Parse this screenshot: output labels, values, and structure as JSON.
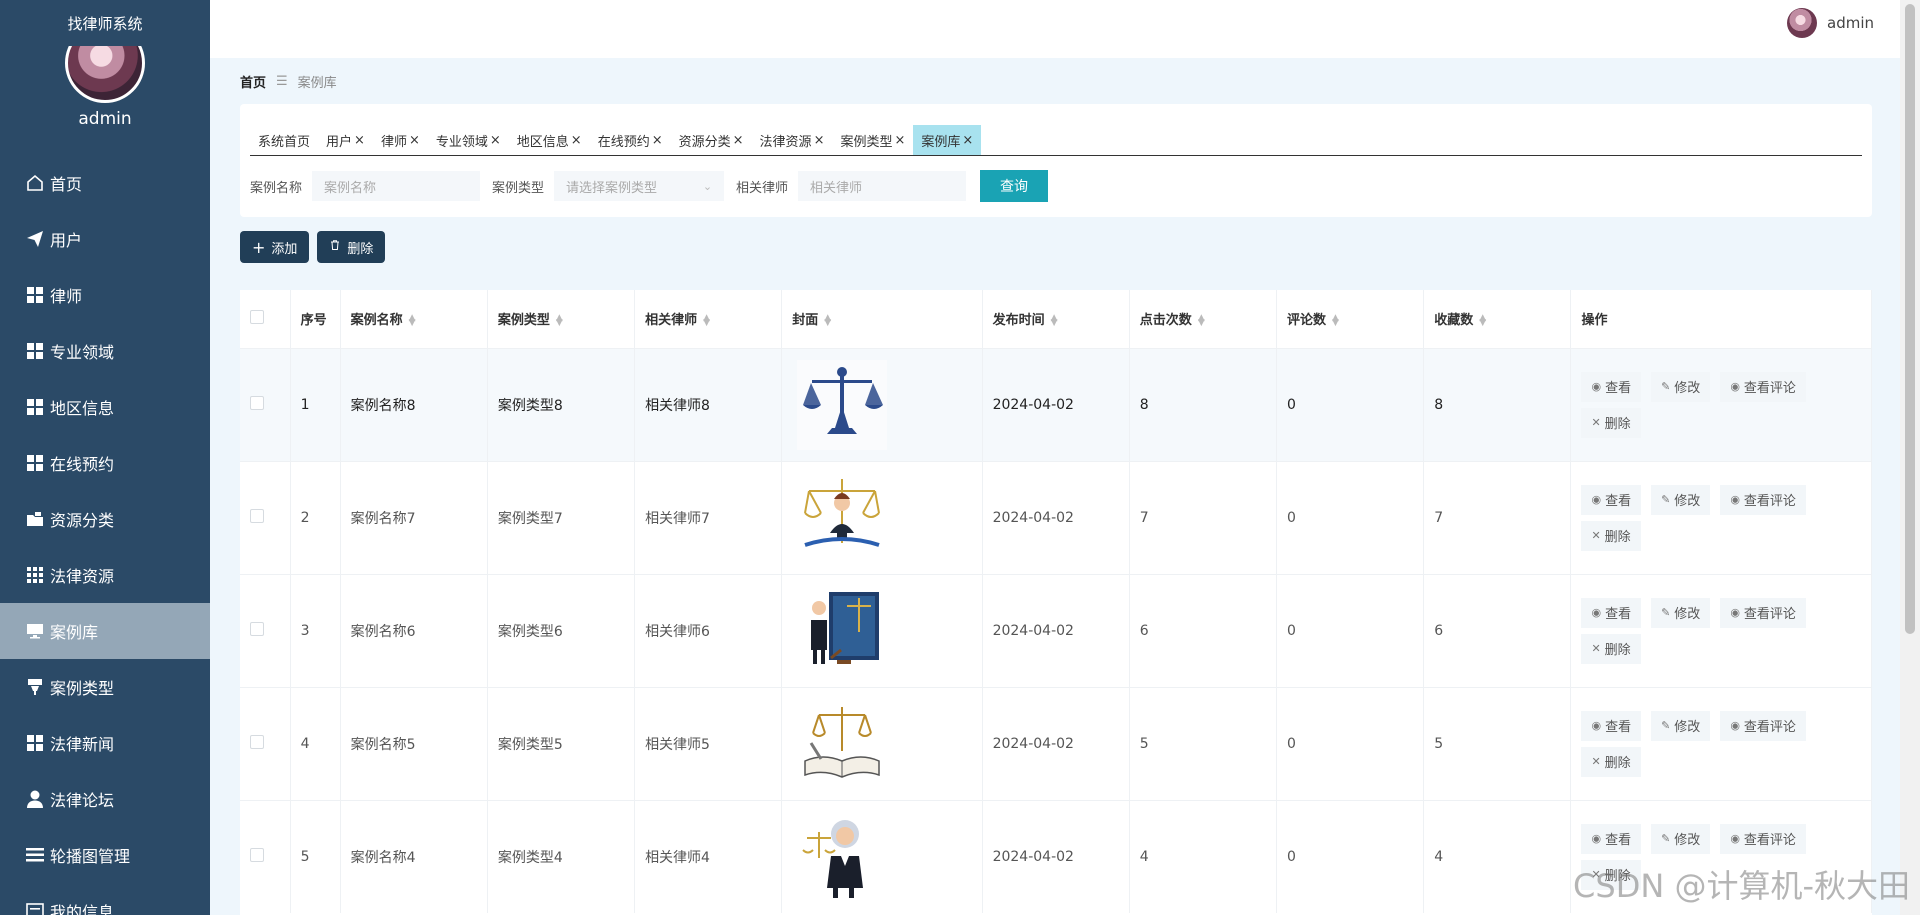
{
  "app": {
    "system_title": "找律师系统",
    "sidebar_user": "admin"
  },
  "header": {
    "username": "admin"
  },
  "sidebar": {
    "items": [
      {
        "label": "首页",
        "icon": "home-icon"
      },
      {
        "label": "用户",
        "icon": "send-icon"
      },
      {
        "label": "律师",
        "icon": "grid-icon"
      },
      {
        "label": "专业领域",
        "icon": "grid-icon"
      },
      {
        "label": "地区信息",
        "icon": "grid-icon"
      },
      {
        "label": "在线预约",
        "icon": "grid-icon"
      },
      {
        "label": "资源分类",
        "icon": "folder-icon"
      },
      {
        "label": "法律资源",
        "icon": "apps-icon"
      },
      {
        "label": "案例库",
        "icon": "monitor-icon",
        "active": true
      },
      {
        "label": "案例类型",
        "icon": "cup-icon"
      },
      {
        "label": "法律新闻",
        "icon": "grid-icon"
      },
      {
        "label": "法律论坛",
        "icon": "user-icon"
      },
      {
        "label": "轮播图管理",
        "icon": "list-icon"
      },
      {
        "label": "我的信息",
        "icon": "card-icon"
      }
    ]
  },
  "breadcrumb": {
    "home": "首页",
    "current": "案例库"
  },
  "tabs": [
    {
      "label": "系统首页",
      "closable": false
    },
    {
      "label": "用户",
      "closable": true
    },
    {
      "label": "律师",
      "closable": true
    },
    {
      "label": "专业领域",
      "closable": true
    },
    {
      "label": "地区信息",
      "closable": true
    },
    {
      "label": "在线预约",
      "closable": true
    },
    {
      "label": "资源分类",
      "closable": true
    },
    {
      "label": "法律资源",
      "closable": true
    },
    {
      "label": "案例类型",
      "closable": true
    },
    {
      "label": "案例库",
      "closable": true,
      "active": true
    }
  ],
  "search": {
    "name_label": "案例名称",
    "name_placeholder": "案例名称",
    "type_label": "案例类型",
    "type_placeholder": "请选择案例类型",
    "lawyer_label": "相关律师",
    "lawyer_placeholder": "相关律师",
    "query_button": "查询"
  },
  "toolbar": {
    "add_label": "添加",
    "delete_label": "删除"
  },
  "table": {
    "columns": [
      "序号",
      "案例名称",
      "案例类型",
      "相关律师",
      "封面",
      "发布时间",
      "点击次数",
      "评论数",
      "收藏数",
      "操作"
    ],
    "ops": {
      "view": "查看",
      "edit": "修改",
      "comments": "查看评论",
      "delete": "删除"
    },
    "rows": [
      {
        "index": "1",
        "name": "案例名称8",
        "type": "案例类型8",
        "lawyer": "相关律师8",
        "cover": "scales-icon",
        "date": "2024-04-02",
        "clicks": "8",
        "comments": "0",
        "favorites": "8"
      },
      {
        "index": "2",
        "name": "案例名称7",
        "type": "案例类型7",
        "lawyer": "相关律师7",
        "cover": "lawyer-scales-icon",
        "date": "2024-04-02",
        "clicks": "7",
        "comments": "0",
        "favorites": "7"
      },
      {
        "index": "3",
        "name": "案例名称6",
        "type": "案例类型6",
        "lawyer": "相关律师6",
        "cover": "lawyer-door-icon",
        "date": "2024-04-02",
        "clicks": "6",
        "comments": "0",
        "favorites": "6"
      },
      {
        "index": "4",
        "name": "案例名称5",
        "type": "案例类型5",
        "lawyer": "相关律师5",
        "cover": "book-scales-icon",
        "date": "2024-04-02",
        "clicks": "5",
        "comments": "0",
        "favorites": "5"
      },
      {
        "index": "5",
        "name": "案例名称4",
        "type": "案例类型4",
        "lawyer": "相关律师4",
        "cover": "judge-icon",
        "date": "2024-04-02",
        "clicks": "4",
        "comments": "0",
        "favorites": "4"
      }
    ]
  },
  "watermark": "CSDN @计算机-秋大田"
}
